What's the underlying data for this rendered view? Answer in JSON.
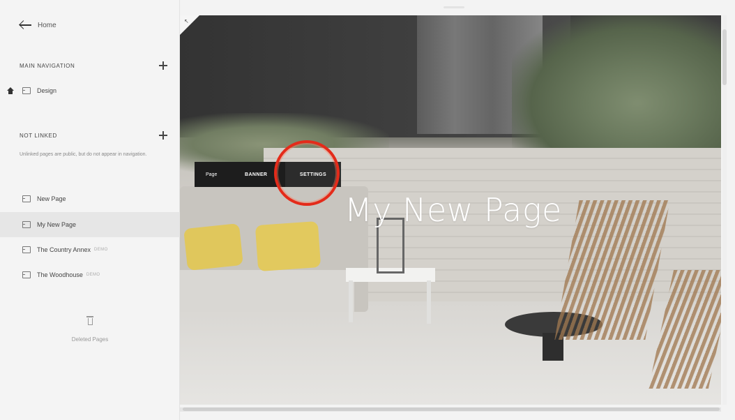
{
  "sidebar": {
    "back_label": "Home",
    "main_navigation": {
      "title": "MAIN NAVIGATION",
      "items": [
        {
          "label": "Design"
        }
      ]
    },
    "not_linked": {
      "title": "NOT LINKED",
      "description": "Unlinked pages are public, but do not appear in navigation.",
      "items": [
        {
          "label": "New Page",
          "tag": ""
        },
        {
          "label": "My New Page",
          "tag": ""
        },
        {
          "label": "The Country Annex",
          "tag": "DEMO"
        },
        {
          "label": "The Woodhouse",
          "tag": "DEMO"
        }
      ]
    },
    "deleted_label": "Deleted Pages"
  },
  "preview": {
    "page_title": "My New Page"
  },
  "toolbar": {
    "page_label": "Page",
    "banner_label": "BANNER",
    "settings_label": "SETTINGS"
  },
  "colors": {
    "highlight": "#e42b1a",
    "toolbar": "#1d1d1d",
    "active_row": "#e6e6e6"
  }
}
